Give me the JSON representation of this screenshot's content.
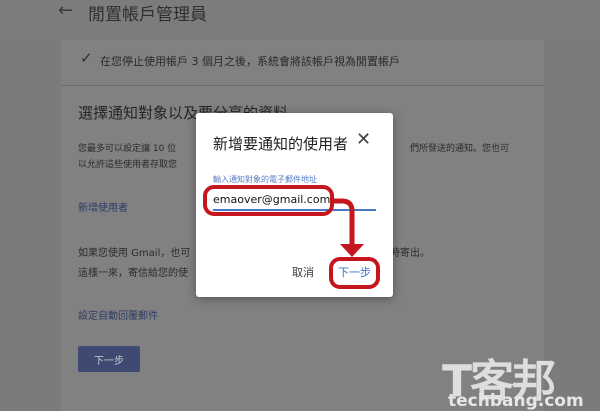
{
  "header": {
    "title": "閒置帳戶管理員",
    "back_icon": "arrow-left-icon"
  },
  "notice": {
    "text": "在您停止使用帳戶 3 個月之後，系統會將該帳戶視為閒置帳戶"
  },
  "section": {
    "title": "選擇通知對象以及要分享的資料",
    "desc_line1_left": "您最多可以設定讓 10 位",
    "desc_line1_right": "們所發送的通知。您也可",
    "desc_line2_left": "以允許這些使用者存取您",
    "add_user_link": "新增使用者",
    "gmail_line1_left": "如果您使用 Gmail，也可",
    "gmail_line1_right": "時寄出。",
    "gmail_line2_left": "這樣一來，寄信給您的使",
    "auto_reply_link": "設定自動回覆郵件",
    "next_label": "下一步"
  },
  "dialog": {
    "title": "新增要通知的使用者",
    "close_icon": "close-icon",
    "field_label": "輸入通知對象的電子郵件地址",
    "email_value": "emaover@gmail.com",
    "cancel_label": "取消",
    "next_label": "下一步"
  },
  "annotation": {
    "color": "#c4161c"
  },
  "watermark": {
    "main": "T客邦",
    "sub": "techbang.com"
  }
}
